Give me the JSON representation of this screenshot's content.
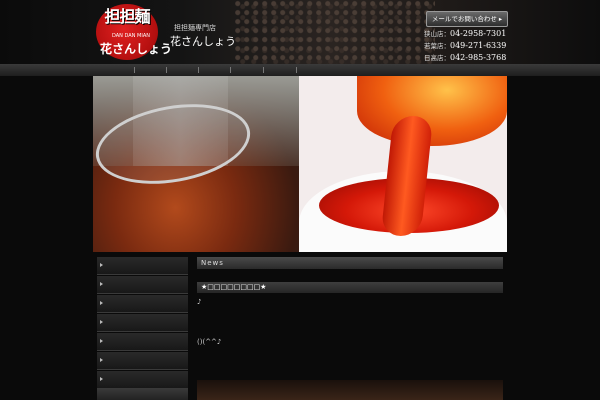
{
  "header": {
    "logo_text": "担担麺",
    "logo_sub": "DAN DAN MIAN",
    "logo_text2": "花さんしょう",
    "shop_small": "担担麺専門店",
    "shop_name": "花さんしょう",
    "mail_button": "メールでお問い合わせ ▸",
    "phones": [
      {
        "label": "狭山店：",
        "number": "04-2958-7301"
      },
      {
        "label": "若葉店：",
        "number": "049-271-6339"
      },
      {
        "label": "日高店：",
        "number": "042-985-3768"
      }
    ]
  },
  "news": {
    "header": "News",
    "title": "★□□□□□□□□★",
    "note": "♪",
    "face": "()(^^♪"
  }
}
